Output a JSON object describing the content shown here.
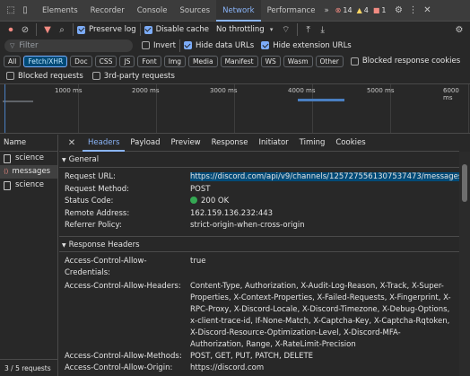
{
  "devtools_tabs": [
    "Elements",
    "Recorder",
    "Console",
    "Sources",
    "Network",
    "Performance"
  ],
  "active_tab": "Network",
  "more_tabs": "»",
  "counts": {
    "errors": "14",
    "warnings": "4",
    "info": "1"
  },
  "toolbar": {
    "preserve_log": "Preserve log",
    "disable_cache": "Disable cache",
    "throttling": "No throttling"
  },
  "filter": {
    "placeholder": "Filter",
    "invert": "Invert",
    "hide_data_urls": "Hide data URLs",
    "hide_extension_urls": "Hide extension URLs"
  },
  "type_filters": [
    "All",
    "Fetch/XHR",
    "Doc",
    "CSS",
    "JS",
    "Font",
    "Img",
    "Media",
    "Manifest",
    "WS",
    "Wasm",
    "Other"
  ],
  "selected_type_filter": "Fetch/XHR",
  "blocked_response_cookies": "Blocked response cookies",
  "blocked_requests": "Blocked requests",
  "third_party_requests": "3rd-party requests",
  "timeline_ticks": [
    "1000 ms",
    "2000 ms",
    "3000 ms",
    "4000 ms",
    "5000 ms",
    "6000 ms"
  ],
  "request_list": {
    "header": "Name",
    "items": [
      "science",
      "messages",
      "science"
    ],
    "footer": "3 / 5 requests"
  },
  "detail_tabs": [
    "Headers",
    "Payload",
    "Preview",
    "Response",
    "Initiator",
    "Timing",
    "Cookies"
  ],
  "active_detail_tab": "Headers",
  "general": {
    "title": "General",
    "rows": [
      {
        "k": "Request URL:",
        "v": "https://discord.com/api/v9/channels/1257275561307537473/messages"
      },
      {
        "k": "Request Method:",
        "v": "POST"
      },
      {
        "k": "Status Code:",
        "v": "200 OK"
      },
      {
        "k": "Remote Address:",
        "v": "162.159.136.232:443"
      },
      {
        "k": "Referrer Policy:",
        "v": "strict-origin-when-cross-origin"
      }
    ]
  },
  "response_headers": {
    "title": "Response Headers",
    "rows": [
      {
        "k": "Access-Control-Allow-Credentials:",
        "v": "true"
      },
      {
        "k": "Access-Control-Allow-Headers:",
        "v": "Content-Type, Authorization, X-Audit-Log-Reason, X-Track, X-Super-Properties, X-Context-Properties, X-Failed-Requests, X-Fingerprint, X-RPC-Proxy, X-Discord-Locale, X-Discord-Timezone, X-Debug-Options, x-client-trace-id, If-None-Match, X-Captcha-Key, X-Captcha-Rqtoken, X-Discord-Resource-Optimization-Level, X-Discord-MFA-Authorization, Range, X-RateLimit-Precision"
      },
      {
        "k": "Access-Control-Allow-Methods:",
        "v": "POST, GET, PUT, PATCH, DELETE"
      },
      {
        "k": "Access-Control-Allow-Origin:",
        "v": "https://discord.com"
      }
    ]
  }
}
